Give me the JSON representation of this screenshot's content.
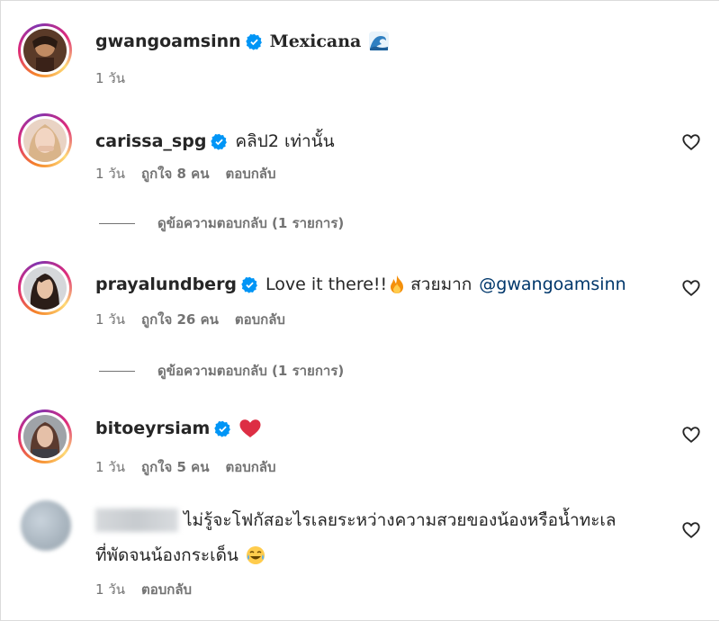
{
  "comments": [
    {
      "username": "gwangoamsinn",
      "text": "Mexicana",
      "emoji": "water-wave-emoji",
      "time": "1 วัน"
    },
    {
      "username": "carissa_spg",
      "text": "คลิป2 เท่านั้น",
      "time": "1 วัน",
      "likes": "ถูกใจ 8 คน",
      "reply": "ตอบกลับ",
      "view_replies": "ดูข้อความตอบกลับ (1 รายการ)"
    },
    {
      "username": "prayalundberg",
      "text_before": "Love it there!!",
      "text_after": "สวยมาก",
      "mention": "@gwangoamsinn",
      "time": "1 วัน",
      "likes": "ถูกใจ 26 คน",
      "reply": "ตอบกลับ",
      "view_replies": "ดูข้อความตอบกลับ (1 รายการ)"
    },
    {
      "username": "bitoeyrsiam",
      "emoji": "red-heart-emoji",
      "time": "1 วัน",
      "likes": "ถูกใจ 5 คน",
      "reply": "ตอบกลับ"
    },
    {
      "text_line1": "ไม่รู้จะโฟกัสอะไรเลยระหว่างความสวยของน้องหรือน้ำทะเล",
      "text_line2": "ที่พัดจนน้องกระเด็น",
      "emoji": "laughing-tears-emoji",
      "time": "1 วัน",
      "reply": "ตอบกลับ"
    }
  ],
  "colors": {
    "verified": "#0095f6",
    "secondary_text": "#737373",
    "mention": "#00376b",
    "heart_red": "#ed4956"
  }
}
